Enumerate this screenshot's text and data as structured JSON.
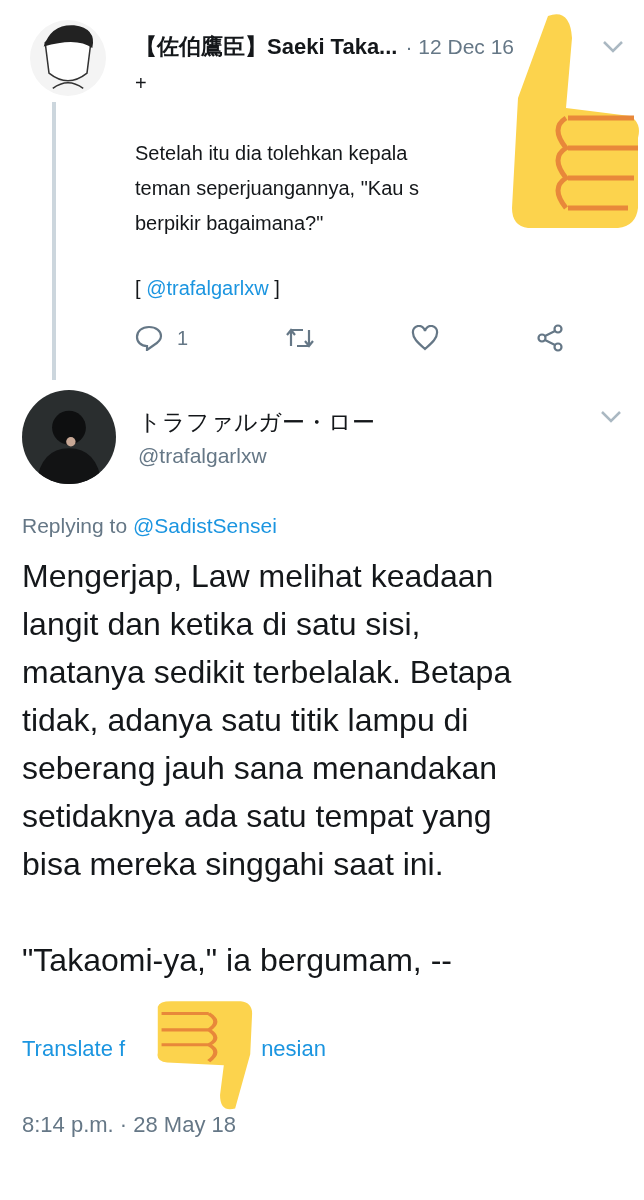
{
  "thread_tweet": {
    "name": "【佐伯鷹臣】Saeki Taka...",
    "time": "· 12 Dec 16",
    "plus": "+",
    "lines": [
      "Setelah itu dia tolehkan kepala",
      "teman seperjuangannya, \"Kau s",
      "berpikir bagaimana?\""
    ],
    "mention_open": "[",
    "mention": "@trafalgarlxw",
    "mention_close": "]",
    "actions": [
      {
        "kind": "reply",
        "count": "1"
      },
      {
        "kind": "retweet"
      },
      {
        "kind": "like"
      },
      {
        "kind": "share"
      }
    ]
  },
  "main_tweet": {
    "name": "トラファルガー・ロー",
    "handle": "@trafalgarlxw",
    "replying_prefix": "Replying to",
    "replying_to": "@SadistSensei",
    "body_lines": [
      "Mengerjap, Law melihat keadaan",
      "langit dan ketika di satu sisi,",
      "matanya sedikit terbelalak. Betapa",
      "tidak, adanya satu titik lampu di",
      "seberang jauh sana menandakan",
      "setidaknya ada satu tempat yang",
      "bisa mereka singgahi saat ini."
    ],
    "closing_line": "\"Takaomi-ya,\" ia bergumam, --",
    "translate_parts": [
      "Translate f",
      "nesian"
    ],
    "timestamp": "8:14 p.m. · 28 May 18"
  },
  "stickers": [
    {
      "kind": "thumbs-up"
    },
    {
      "kind": "thumbs-down"
    }
  ]
}
